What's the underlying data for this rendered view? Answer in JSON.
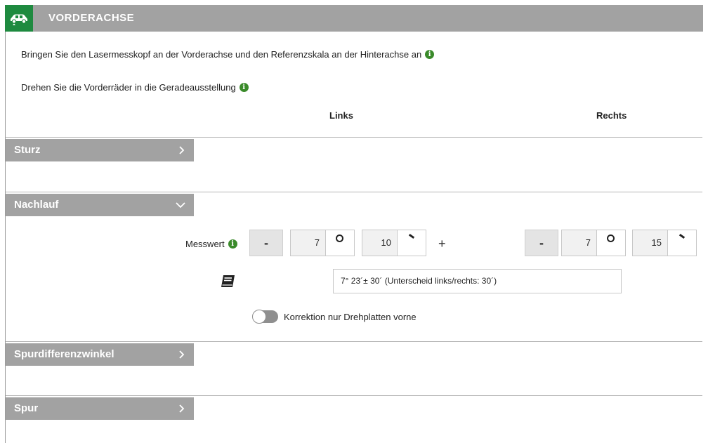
{
  "header": {
    "title": "VORDERACHSE",
    "icon": "car-lift-icon",
    "accent_color": "#1e8a3f"
  },
  "instructions": [
    "Bringen Sie den Lasermesskopf an der Vorderachse und den Referenzskala an der Hinterachse an",
    "Drehen Sie die Vorderräder in die Geradeausstellung"
  ],
  "columns": {
    "left": "Links",
    "right": "Rechts"
  },
  "sections": {
    "sturz": {
      "label": "Sturz",
      "expanded": false
    },
    "nachlauf": {
      "label": "Nachlauf",
      "expanded": true
    },
    "spurdifferenzwinkel": {
      "label": "Spurdifferenzwinkel",
      "expanded": false
    },
    "spur": {
      "label": "Spur",
      "expanded": false
    }
  },
  "nachlauf": {
    "measure_label": "Messwert",
    "minus": "-",
    "plus": "+",
    "left": {
      "degrees": "7",
      "minutes": "10"
    },
    "right": {
      "degrees": "7",
      "minutes": "15"
    },
    "spec": "7° 23´± 30´ (Unterscheid links/rechts: 30´)",
    "toggle_label": "Korrektion nur Drehplatten vorne",
    "toggle_on": false
  }
}
